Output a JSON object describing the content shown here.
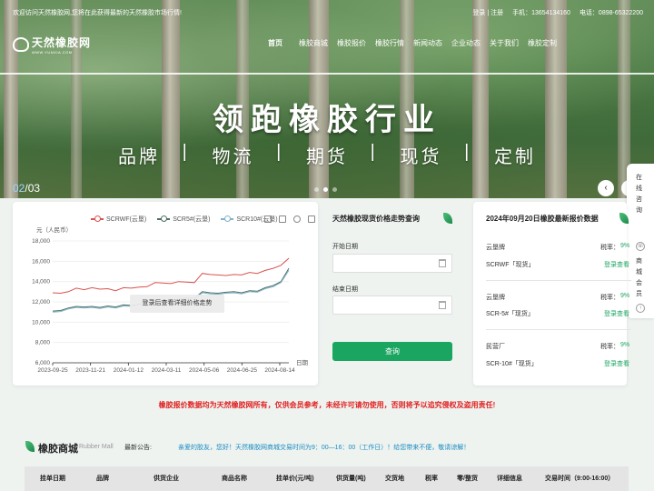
{
  "header": {
    "welcome": "欢迎访问天然橡胶网,您将在此获得最新的天然橡胶市场行情!",
    "links": [
      "登录 | 注册",
      "手机：13654134160",
      "电话：0898-65322200"
    ],
    "logo": {
      "name": "天然橡胶网",
      "domain": "WWW.YUNXIA.COM"
    },
    "nav": [
      {
        "label": "首页",
        "active": true
      },
      {
        "label": "橡胶商城",
        "active": false
      },
      {
        "label": "橡胶报价",
        "active": false
      },
      {
        "label": "橡胶行情",
        "active": false
      },
      {
        "label": "新闻动态",
        "active": false
      },
      {
        "label": "企业动态",
        "active": false
      },
      {
        "label": "关于我们",
        "active": false
      },
      {
        "label": "橡胶定制",
        "active": false
      }
    ]
  },
  "banner": {
    "slogan": "领跑橡胶行业",
    "tags": [
      "品牌",
      "|",
      "物流",
      "|",
      "期货",
      "|",
      "现货",
      "|",
      "定制"
    ],
    "counter_current": "02",
    "counter_total": "/03",
    "active_slide": 2,
    "slide_count": 3,
    "prev_label": "‹",
    "next_label": "›"
  },
  "side_widget": {
    "service": "在线咨询",
    "member": "商城会员"
  },
  "chart_data": {
    "type": "line",
    "ylabel": "元（人民币）",
    "xlabel": "日期",
    "ylim": [
      6000,
      18000
    ],
    "yticks": [
      "18,000",
      "16,000",
      "14,000",
      "12,000",
      "10,000",
      "8,000",
      "6,000"
    ],
    "xticks": [
      "2023-09-25",
      "2023-11-21",
      "2024-01-12",
      "2024-03-11",
      "2024-05-06",
      "2024-06-25",
      "2024-08-14"
    ],
    "series": [
      {
        "name": "SCRWF(云垦)",
        "color": "#d9534f",
        "values": [
          12900,
          12850,
          13000,
          13350,
          13200,
          13400,
          13250,
          13300,
          13100,
          13400,
          13350,
          13450,
          13500,
          13900,
          13850,
          13800,
          14000,
          13950,
          13900,
          14800,
          14700,
          14650,
          14600,
          14700,
          14650,
          14900,
          14800,
          15100,
          15300,
          15600,
          16300
        ]
      },
      {
        "name": "SCR5#(云垦)",
        "color": "#4d6f66",
        "values": [
          11100,
          11150,
          11400,
          11550,
          11500,
          11550,
          11450,
          11600,
          11500,
          11700,
          11650,
          11800,
          11900,
          12100,
          12200,
          12000,
          12300,
          12400,
          12350,
          13000,
          12900,
          12850,
          12950,
          13000,
          12900,
          13100,
          13050,
          13400,
          13600,
          14000,
          15300
        ]
      },
      {
        "name": "SCR10#(云垦)",
        "color": "#7fb3c8",
        "values": [
          11000,
          11050,
          11300,
          11450,
          11400,
          11450,
          11350,
          11500,
          11400,
          11600,
          11550,
          11700,
          11800,
          12000,
          12100,
          11900,
          12200,
          12300,
          12250,
          12900,
          12800,
          12750,
          12850,
          12900,
          12800,
          13000,
          12950,
          13300,
          13500,
          13900,
          15100
        ]
      }
    ],
    "overlay": "登录后查看详细价格走势"
  },
  "query": {
    "title": "天然橡胶现货价格走势查询",
    "start_label": "开始日期",
    "end_label": "结束日期",
    "start_placeholder": "",
    "end_placeholder": "",
    "button": "查询"
  },
  "prices": {
    "title": "2024年09月20日橡胶最新报价数据",
    "tax_label": "税率：",
    "link_label": "登录查看",
    "items": [
      {
        "source": "云垦牌",
        "product": "SCRWF「现货」",
        "tax": "9%"
      },
      {
        "source": "云垦牌",
        "product": "SCR-5#「现货」",
        "tax": "9%"
      },
      {
        "source": "民营厂",
        "product": "SCR-10#「现货」",
        "tax": "9%"
      }
    ]
  },
  "notice": "橡胶报价数据均为天然橡胶网所有，仅供会员参考，未经许可请勿使用，否则将予以追究侵权及盗用责任!",
  "mall": {
    "title": "橡胶商城",
    "subtitle": "Rubber Mall",
    "announce_label": "最新公告:",
    "announce_text": "亲爱的胶友，您好！天然橡胶网商城交易时间为9：00—16：00（工作日）！给您带来不便，敬请谅解！",
    "columns": [
      "挂单日期",
      "品牌",
      "供货企业",
      "商品名称",
      "挂单价(元/吨)",
      "供货量(吨)",
      "交货地",
      "税率",
      "零/整货",
      "详细信息",
      "交易时间（9:00-16:00）"
    ]
  }
}
